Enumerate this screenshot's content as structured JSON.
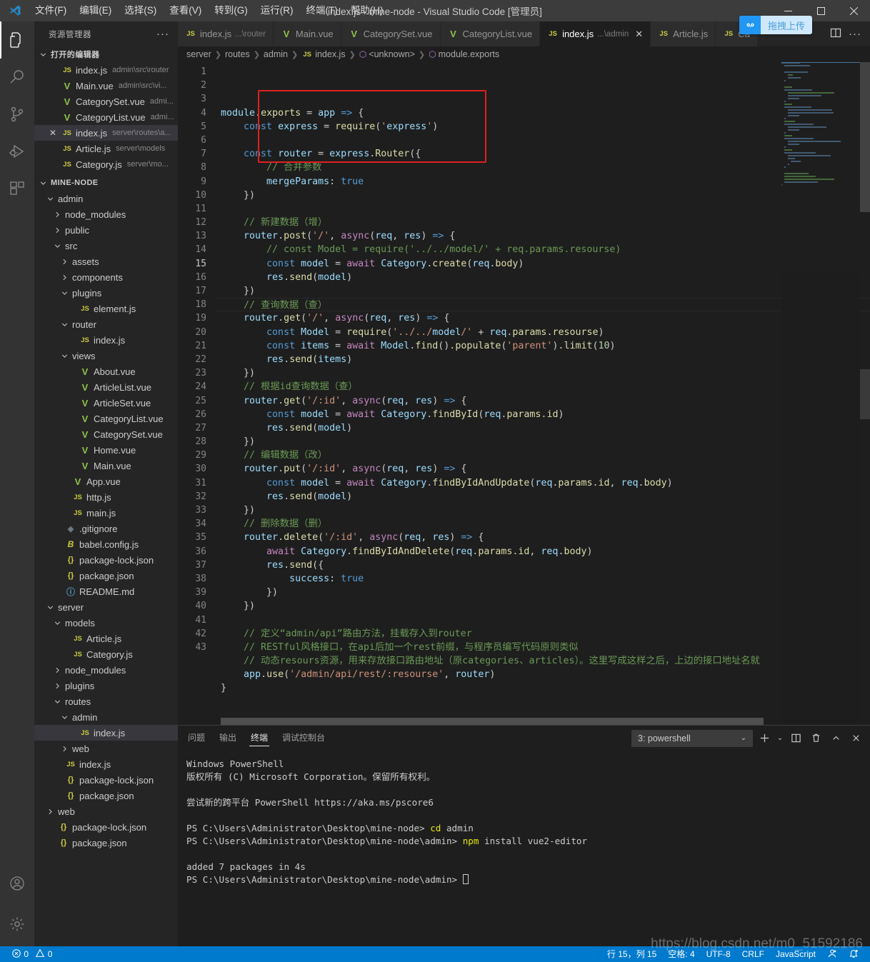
{
  "titlebar": {
    "window_title": "index.js - mine-node - Visual Studio Code [管理员]",
    "menus": [
      "文件(F)",
      "编辑(E)",
      "选择(S)",
      "查看(V)",
      "转到(G)",
      "运行(R)",
      "终端(T)",
      "帮助(H)"
    ],
    "controls": {
      "minimize": "—",
      "maximize": "▢",
      "close": "✕"
    }
  },
  "activitybar": {
    "items": [
      {
        "name": "explorer-icon",
        "label": "资源管理器",
        "active": true
      },
      {
        "name": "search-icon",
        "label": "搜索",
        "active": false
      },
      {
        "name": "source-control-icon",
        "label": "源代码管理",
        "active": false
      },
      {
        "name": "run-debug-icon",
        "label": "运行和调试",
        "active": false
      },
      {
        "name": "extensions-icon",
        "label": "扩展",
        "active": false
      }
    ],
    "bottom": [
      {
        "name": "account-icon",
        "label": "账户"
      },
      {
        "name": "settings-gear-icon",
        "label": "管理"
      }
    ]
  },
  "sidebar": {
    "title": "资源管理器",
    "more_actions": "···",
    "open_editors": {
      "label": "打开的编辑器",
      "expanded": true,
      "items": [
        {
          "icon": "js",
          "name": "index.js",
          "path": "admin\\src\\router",
          "selected": false,
          "closable": false
        },
        {
          "icon": "vue",
          "name": "Main.vue",
          "path": "admin\\src\\vi...",
          "selected": false,
          "closable": false
        },
        {
          "icon": "vue",
          "name": "CategorySet.vue",
          "path": "admi...",
          "selected": false,
          "closable": false
        },
        {
          "icon": "vue",
          "name": "CategoryList.vue",
          "path": "admi...",
          "selected": false,
          "closable": false
        },
        {
          "icon": "js",
          "name": "index.js",
          "path": "server\\routes\\a...",
          "selected": true,
          "closable": true
        },
        {
          "icon": "js",
          "name": "Article.js",
          "path": "server\\models",
          "selected": false,
          "closable": false
        },
        {
          "icon": "js",
          "name": "Category.js",
          "path": "server\\mo...",
          "selected": false,
          "closable": false
        }
      ]
    },
    "workspace": {
      "label": "MINE-NODE",
      "expanded": true,
      "tree": [
        {
          "indent": 1,
          "type": "folder",
          "state": "open",
          "name": "admin"
        },
        {
          "indent": 2,
          "type": "folder",
          "state": "closed",
          "name": "node_modules"
        },
        {
          "indent": 2,
          "type": "folder",
          "state": "closed",
          "name": "public"
        },
        {
          "indent": 2,
          "type": "folder",
          "state": "open",
          "name": "src"
        },
        {
          "indent": 3,
          "type": "folder",
          "state": "closed",
          "name": "assets"
        },
        {
          "indent": 3,
          "type": "folder",
          "state": "closed",
          "name": "components"
        },
        {
          "indent": 3,
          "type": "folder",
          "state": "open",
          "name": "plugins"
        },
        {
          "indent": 4,
          "type": "file",
          "icon": "js",
          "name": "element.js"
        },
        {
          "indent": 3,
          "type": "folder",
          "state": "open",
          "name": "router"
        },
        {
          "indent": 4,
          "type": "file",
          "icon": "js",
          "name": "index.js"
        },
        {
          "indent": 3,
          "type": "folder",
          "state": "open",
          "name": "views"
        },
        {
          "indent": 4,
          "type": "file",
          "icon": "vue",
          "name": "About.vue"
        },
        {
          "indent": 4,
          "type": "file",
          "icon": "vue",
          "name": "ArticleList.vue"
        },
        {
          "indent": 4,
          "type": "file",
          "icon": "vue",
          "name": "ArticleSet.vue"
        },
        {
          "indent": 4,
          "type": "file",
          "icon": "vue",
          "name": "CategoryList.vue"
        },
        {
          "indent": 4,
          "type": "file",
          "icon": "vue",
          "name": "CategorySet.vue"
        },
        {
          "indent": 4,
          "type": "file",
          "icon": "vue",
          "name": "Home.vue"
        },
        {
          "indent": 4,
          "type": "file",
          "icon": "vue",
          "name": "Main.vue"
        },
        {
          "indent": 3,
          "type": "file",
          "icon": "vue",
          "name": "App.vue"
        },
        {
          "indent": 3,
          "type": "file",
          "icon": "js",
          "name": "http.js"
        },
        {
          "indent": 3,
          "type": "file",
          "icon": "js",
          "name": "main.js"
        },
        {
          "indent": 2,
          "type": "file",
          "icon": "git",
          "name": ".gitignore"
        },
        {
          "indent": 2,
          "type": "file",
          "icon": "babel",
          "name": "babel.config.js"
        },
        {
          "indent": 2,
          "type": "file",
          "icon": "json",
          "name": "package-lock.json"
        },
        {
          "indent": 2,
          "type": "file",
          "icon": "json",
          "name": "package.json"
        },
        {
          "indent": 2,
          "type": "file",
          "icon": "md",
          "name": "README.md"
        },
        {
          "indent": 1,
          "type": "folder",
          "state": "open",
          "name": "server"
        },
        {
          "indent": 2,
          "type": "folder",
          "state": "open",
          "name": "models"
        },
        {
          "indent": 3,
          "type": "file",
          "icon": "js",
          "name": "Article.js"
        },
        {
          "indent": 3,
          "type": "file",
          "icon": "js",
          "name": "Category.js"
        },
        {
          "indent": 2,
          "type": "folder",
          "state": "closed",
          "name": "node_modules"
        },
        {
          "indent": 2,
          "type": "folder",
          "state": "closed",
          "name": "plugins"
        },
        {
          "indent": 2,
          "type": "folder",
          "state": "open",
          "name": "routes"
        },
        {
          "indent": 3,
          "type": "folder",
          "state": "open",
          "name": "admin"
        },
        {
          "indent": 4,
          "type": "file",
          "icon": "js",
          "name": "index.js",
          "selected": true
        },
        {
          "indent": 3,
          "type": "folder",
          "state": "closed",
          "name": "web"
        },
        {
          "indent": 2,
          "type": "file",
          "icon": "js",
          "name": "index.js"
        },
        {
          "indent": 2,
          "type": "file",
          "icon": "json",
          "name": "package-lock.json"
        },
        {
          "indent": 2,
          "type": "file",
          "icon": "json",
          "name": "package.json"
        },
        {
          "indent": 1,
          "type": "folder",
          "state": "closed",
          "name": "web"
        },
        {
          "indent": 1,
          "type": "file",
          "icon": "json",
          "name": "package-lock.json"
        },
        {
          "indent": 1,
          "type": "file",
          "icon": "json",
          "name": "package.json"
        }
      ]
    }
  },
  "tabs": [
    {
      "icon": "js",
      "name": "index.js",
      "path": "...\\router",
      "active": false,
      "close": false
    },
    {
      "icon": "vue",
      "name": "Main.vue",
      "path": "",
      "active": false,
      "close": false
    },
    {
      "icon": "vue",
      "name": "CategorySet.vue",
      "path": "",
      "active": false,
      "close": false
    },
    {
      "icon": "vue",
      "name": "CategoryList.vue",
      "path": "",
      "active": false,
      "close": false
    },
    {
      "icon": "js",
      "name": "index.js",
      "path": "...\\admin",
      "active": true,
      "close": true
    },
    {
      "icon": "js",
      "name": "Article.js",
      "path": "",
      "active": false,
      "close": false
    },
    {
      "icon": "js",
      "name": "Ca",
      "path": "",
      "active": false,
      "close": false
    }
  ],
  "tab_actions": {
    "split_editor": "split-editor-icon",
    "more": "···"
  },
  "upload_overlay": {
    "label": "拖拽上传",
    "icon": "baidu-cloud-icon",
    "bg": "#cfe8fb",
    "accent": "#2196f3"
  },
  "breadcrumb": [
    "server",
    "routes",
    "admin",
    "index.js",
    "<unknown>",
    "module.exports"
  ],
  "editor": {
    "total_lines": 43,
    "current_line": 15,
    "highlight_box": {
      "from_line": 3,
      "to_line": 7,
      "color": "#e02020"
    },
    "lines": [
      {
        "n": 1,
        "t": "module.exports = app => {"
      },
      {
        "n": 2,
        "t": "    const express = require('express')"
      },
      {
        "n": 3,
        "t": ""
      },
      {
        "n": 4,
        "t": "    const router = express.Router({"
      },
      {
        "n": 5,
        "t": "        // 合并参数"
      },
      {
        "n": 6,
        "t": "        mergeParams: true"
      },
      {
        "n": 7,
        "t": "    })"
      },
      {
        "n": 8,
        "t": ""
      },
      {
        "n": 9,
        "t": "    // 新建数据（增）"
      },
      {
        "n": 10,
        "t": "    router.post('/', async(req, res) => {"
      },
      {
        "n": 11,
        "t": "        // const Model = require('../../model/' + req.params.resourse)"
      },
      {
        "n": 12,
        "t": "        const model = await Category.create(req.body)"
      },
      {
        "n": 13,
        "t": "        res.send(model)"
      },
      {
        "n": 14,
        "t": "    })"
      },
      {
        "n": 15,
        "t": "    // 查询数据（查）"
      },
      {
        "n": 16,
        "t": "    router.get('/', async(req, res) => {"
      },
      {
        "n": 17,
        "t": "        const Model = require('../../model/' + req.params.resourse)"
      },
      {
        "n": 18,
        "t": "        const items = await Model.find().populate('parent').limit(10)"
      },
      {
        "n": 19,
        "t": "        res.send(items)"
      },
      {
        "n": 20,
        "t": "    })"
      },
      {
        "n": 21,
        "t": "    // 根据id查询数据（查）"
      },
      {
        "n": 22,
        "t": "    router.get('/:id', async(req, res) => {"
      },
      {
        "n": 23,
        "t": "        const model = await Category.findById(req.params.id)"
      },
      {
        "n": 24,
        "t": "        res.send(model)"
      },
      {
        "n": 25,
        "t": "    })"
      },
      {
        "n": 26,
        "t": "    // 编辑数据（改）"
      },
      {
        "n": 27,
        "t": "    router.put('/:id', async(req, res) => {"
      },
      {
        "n": 28,
        "t": "        const model = await Category.findByIdAndUpdate(req.params.id, req.body)"
      },
      {
        "n": 29,
        "t": "        res.send(model)"
      },
      {
        "n": 30,
        "t": "    })"
      },
      {
        "n": 31,
        "t": "    // 删除数据（删）"
      },
      {
        "n": 32,
        "t": "    router.delete('/:id', async(req, res) => {"
      },
      {
        "n": 33,
        "t": "        await Category.findByIdAndDelete(req.params.id, req.body)"
      },
      {
        "n": 34,
        "t": "        res.send({"
      },
      {
        "n": 35,
        "t": "            success: true"
      },
      {
        "n": 36,
        "t": "        })"
      },
      {
        "n": 37,
        "t": "    })"
      },
      {
        "n": 38,
        "t": ""
      },
      {
        "n": 39,
        "t": "    // 定义“admin/api”路由方法，挂载存入到router"
      },
      {
        "n": 40,
        "t": "    // RESTful风格接口，在api后加一个rest前缀，与程序员编写代码原则类似"
      },
      {
        "n": 41,
        "t": "    // 动态resours资源，用来存放接口路由地址（原categories、articles）。这里写成这样之后，上边的接口地址名就"
      },
      {
        "n": 42,
        "t": "    app.use('/admin/api/rest/:resourse', router)"
      },
      {
        "n": 43,
        "t": "}"
      }
    ]
  },
  "panel": {
    "tabs": [
      "问题",
      "输出",
      "终端",
      "调试控制台"
    ],
    "active_tab": "终端",
    "terminal_select": "3: powershell",
    "actions": [
      "new-terminal-icon",
      "split-terminal-icon",
      "kill-terminal-icon",
      "maximize-panel-icon",
      "close-panel-icon"
    ],
    "terminal_text": "Windows PowerShell\n版权所有 (C) Microsoft Corporation。保留所有权利。\n\n尝试新的跨平台 PowerShell https://aka.ms/pscore6\n\nPS C:\\Users\\Administrator\\Desktop\\mine-node> cd admin\nPS C:\\Users\\Administrator\\Desktop\\mine-node\\admin> npm install vue2-editor\n\nadded 7 packages in 4s\nPS C:\\Users\\Administrator\\Desktop\\mine-node\\admin> ",
    "terminal_lines": [
      {
        "text": "Windows PowerShell"
      },
      {
        "text": "版权所有 (C) Microsoft Corporation。保留所有权利。"
      },
      {
        "text": ""
      },
      {
        "text": "尝试新的跨平台 PowerShell https://aka.ms/pscore6"
      },
      {
        "text": ""
      },
      {
        "prompt": "PS C:\\Users\\Administrator\\Desktop\\mine-node> ",
        "cmd": "cd",
        "args": " admin"
      },
      {
        "prompt": "PS C:\\Users\\Administrator\\Desktop\\mine-node\\admin> ",
        "cmd": "npm",
        "args": " install vue2-editor"
      },
      {
        "text": ""
      },
      {
        "text": "added 7 packages in 4s"
      },
      {
        "prompt": "PS C:\\Users\\Administrator\\Desktop\\mine-node\\admin> ",
        "cmd": "",
        "args": "",
        "cursor": true
      }
    ]
  },
  "statusbar": {
    "errors": "0",
    "warnings": "0",
    "cursor_position": "行 15，列 15",
    "indentation": "空格: 4",
    "encoding": "UTF-8",
    "eol": "CRLF",
    "language": "JavaScript",
    "feedback_icon": "smiley-icon",
    "bell_icon": "bell-icon",
    "accent_color": "#007acc"
  },
  "watermark": {
    "text": "https://blog.csdn.net/m0_51592186"
  }
}
